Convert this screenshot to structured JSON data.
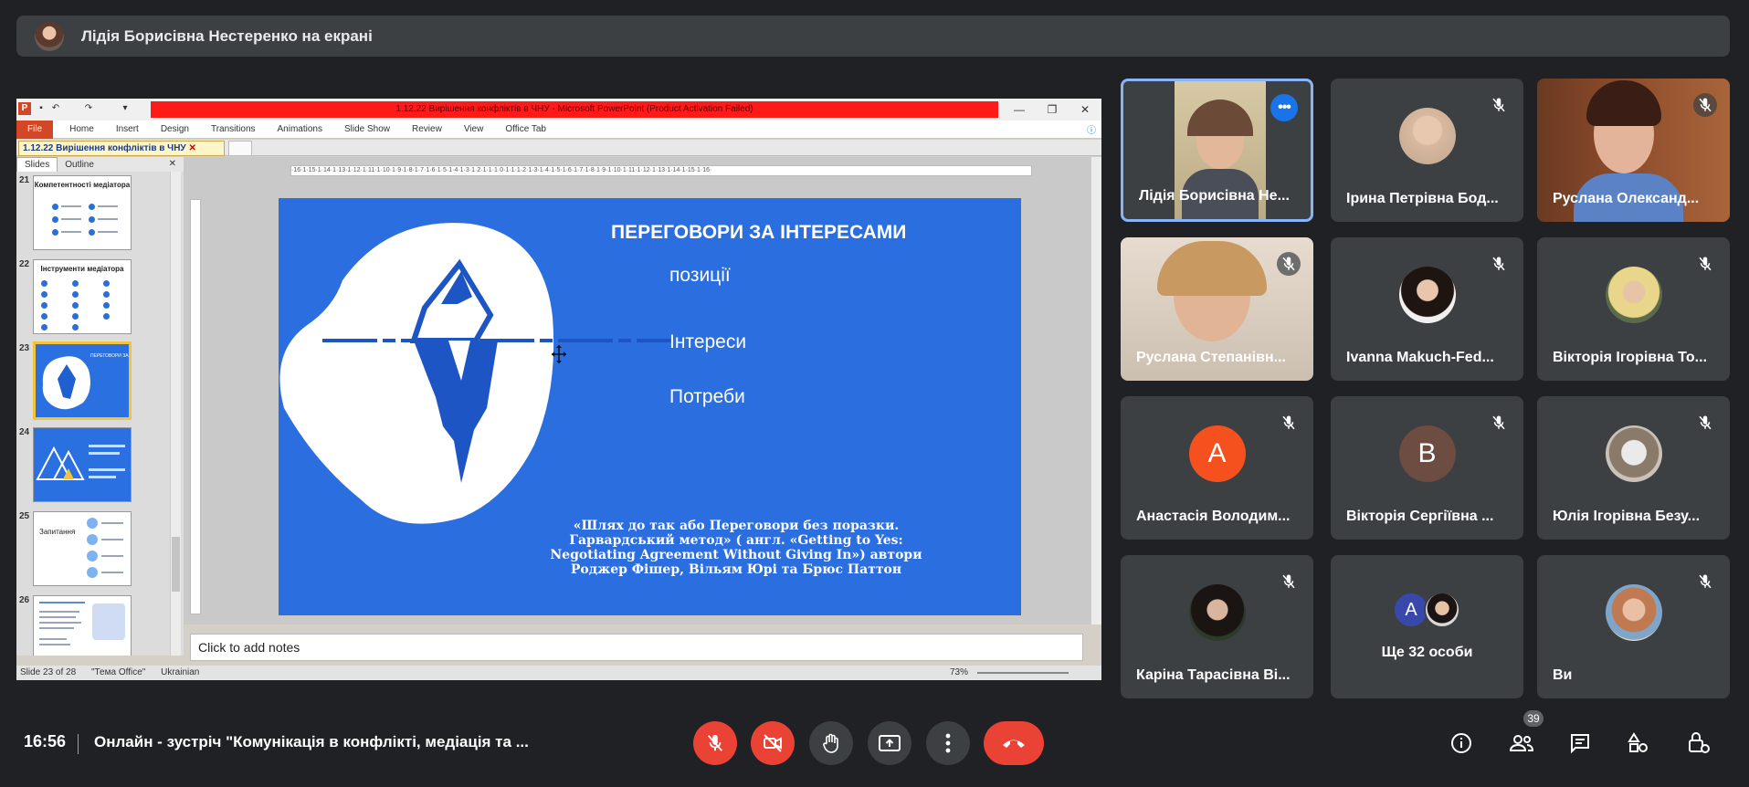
{
  "presenter_banner": {
    "text": "Лідія Борисівна Нестеренко на екрані"
  },
  "powerpoint": {
    "window_title": "1.12.22 Вирішення конфліктів в ЧНУ - Microsoft PowerPoint (Product Activation Failed)",
    "ribbon_tabs": [
      "File",
      "Home",
      "Insert",
      "Design",
      "Transitions",
      "Animations",
      "Slide Show",
      "Review",
      "View",
      "Office Tab"
    ],
    "doc_tab": "1.12.22 Вирішення конфліктів в ЧНУ",
    "panel_tabs": [
      "Slides",
      "Outline"
    ],
    "thumbnails": [
      {
        "num": "21",
        "title": "Компетентності медіатора"
      },
      {
        "num": "22",
        "title": "Інструменти медіатора"
      },
      {
        "num": "23",
        "title": "ПЕРЕГОВОРИ ЗА ІНТЕРЕСАМИ"
      },
      {
        "num": "24",
        "title": ""
      },
      {
        "num": "25",
        "title": "Запитання"
      },
      {
        "num": "26",
        "title": ""
      }
    ],
    "slide": {
      "title": "ПЕРЕГОВОРИ ЗА ІНТЕРЕСАМИ",
      "labels": [
        "позиції",
        "Інтереси",
        "Потреби"
      ],
      "quote": "«Шлях до так або Переговори без поразки. Гарвардський метод» ( англ. «Getting to Yes: Negotiating Agreement Without Giving In») автори Роджер Фішер, Вільям Юрі та Брюс Паттон"
    },
    "notes_placeholder": "Click to add notes",
    "status": {
      "slide": "Slide 23 of 28",
      "theme": "\"Тема Office\"",
      "language": "Ukrainian",
      "zoom": "73%"
    }
  },
  "participants": [
    {
      "name": "Лідія Борисівна Не...",
      "active": true,
      "avatar": "video"
    },
    {
      "name": "Ірина Петрівна Бод...",
      "muted": true,
      "avatar": "photo"
    },
    {
      "name": "Руслана Олександ...",
      "muted": true,
      "avatar": "video"
    },
    {
      "name": "Руслана Степанівн...",
      "muted": true,
      "avatar": "video"
    },
    {
      "name": "Ivanna Makuch-Fed...",
      "muted": true,
      "avatar": "photo"
    },
    {
      "name": "Вікторія Ігорівна То...",
      "muted": true,
      "avatar": "photo"
    },
    {
      "name": "Анастасія Володим...",
      "muted": true,
      "avatar": "letter",
      "letter": "А",
      "color": "#f4511e"
    },
    {
      "name": "Вікторія Сергіївна ...",
      "muted": true,
      "avatar": "letter",
      "letter": "В",
      "color": "#6d4c41"
    },
    {
      "name": "Юлія Ігорівна Безу...",
      "muted": true,
      "avatar": "photo"
    },
    {
      "name": "Каріна Тарасівна Ві...",
      "muted": true,
      "avatar": "photo"
    },
    {
      "name": "Ще 32 особи",
      "avatar": "group",
      "letter": "А",
      "color": "#3949ab"
    },
    {
      "name": "Ви",
      "muted": true,
      "avatar": "photo"
    }
  ],
  "bottom_bar": {
    "time": "16:56",
    "meeting_title": "Онлайн - зустріч \"Комунікація в конфлікті, медіація та ...",
    "people_count": "39"
  },
  "colors": {
    "background": "#202124",
    "tile": "#3c4043",
    "red": "#ea4335",
    "active_border": "#8ab4f8",
    "slide_blue": "#2b6ee0"
  },
  "icons": [
    "mic-off-icon",
    "camera-off-icon",
    "raise-hand-icon",
    "present-icon",
    "more-icon",
    "hang-up-icon",
    "info-icon",
    "people-icon",
    "chat-icon",
    "activities-icon",
    "host-controls-icon"
  ]
}
